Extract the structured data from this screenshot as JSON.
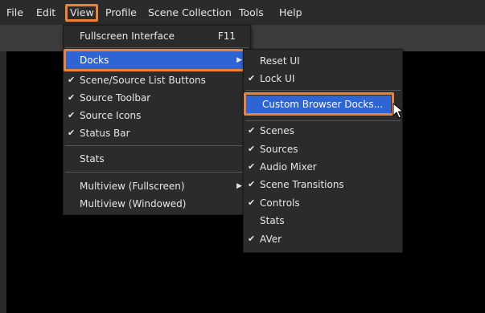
{
  "menubar": {
    "items": [
      {
        "label": "File"
      },
      {
        "label": "Edit"
      },
      {
        "label": "View"
      },
      {
        "label": "Profile"
      },
      {
        "label": "Scene Collection"
      },
      {
        "label": "Tools"
      },
      {
        "label": "Help"
      }
    ]
  },
  "view_menu": {
    "fullscreen_label": "Fullscreen Interface",
    "fullscreen_shortcut": "F11",
    "docks_label": "Docks",
    "scene_source_list_buttons": "Scene/Source List Buttons",
    "source_toolbar": "Source Toolbar",
    "source_icons": "Source Icons",
    "status_bar": "Status Bar",
    "stats": "Stats",
    "multiview_fullscreen": "Multiview (Fullscreen)",
    "multiview_windowed": "Multiview (Windowed)"
  },
  "docks_menu": {
    "reset_ui": "Reset UI",
    "lock_ui": "Lock UI",
    "custom_browser_docks": "Custom Browser Docks...",
    "scenes": "Scenes",
    "sources": "Sources",
    "audio_mixer": "Audio Mixer",
    "scene_transitions": "Scene Transitions",
    "controls": "Controls",
    "stats": "Stats",
    "aver": "AVer"
  },
  "glyphs": {
    "check": "✔",
    "submenu_arrow": "▶"
  },
  "colors": {
    "highlight_border": "#f08233",
    "selection": "#2f64d5",
    "menu_bg": "#2b2b2b",
    "canvas": "#000000"
  }
}
